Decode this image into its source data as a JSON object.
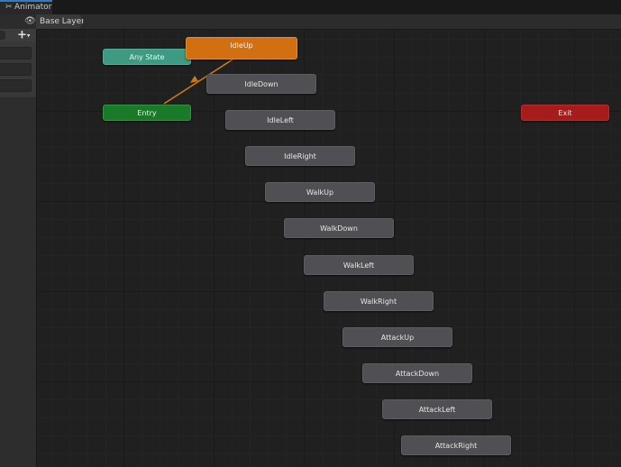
{
  "window": {
    "tab_label": "Animator",
    "tab_icon": "animator-icon"
  },
  "breadcrumb": {
    "eye_icon": "eye-icon",
    "layer_label": "Base Layer"
  },
  "parameters_panel": {
    "add_label": "+",
    "add_dropdown_glyph": "▾"
  },
  "graph": {
    "special_states": {
      "any_state": "Any State",
      "entry": "Entry",
      "exit": "Exit"
    },
    "default_state": "IdleUp",
    "states": [
      "IdleDown",
      "IdleLeft",
      "IdleRight",
      "WalkUp",
      "WalkDown",
      "WalkLeft",
      "WalkRight",
      "AttackUp",
      "AttackDown",
      "AttackLeft",
      "AttackRight"
    ],
    "colors": {
      "background": "#202020",
      "state": "#505054",
      "default_state": "#d16f11",
      "any_state": "#3f9a84",
      "entry": "#1a7a2a",
      "exit": "#a61b1b",
      "default_transition": "#d07a14"
    }
  }
}
